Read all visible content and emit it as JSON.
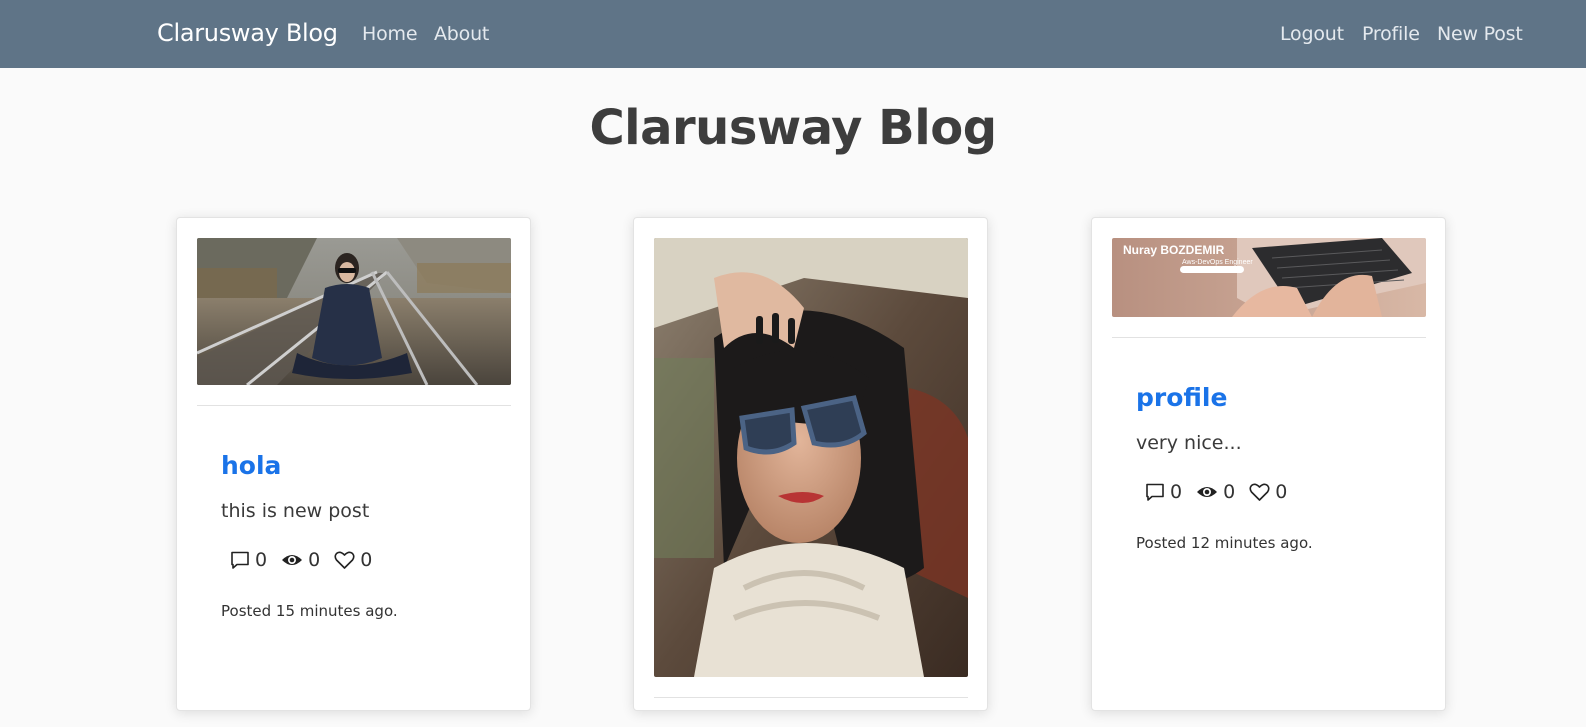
{
  "navbar": {
    "brand": "Clarusway Blog",
    "left_links": [
      "Home",
      "About"
    ],
    "right_links": [
      "Logout",
      "Profile",
      "New Post"
    ]
  },
  "page": {
    "title": "Clarusway Blog"
  },
  "posts": [
    {
      "title": "hola",
      "body": "this is new post",
      "comments": "0",
      "views": "0",
      "likes": "0",
      "posted": "Posted 15 minutes ago."
    },
    {
      "title": "",
      "body": "",
      "comments": "",
      "views": "",
      "likes": "",
      "posted": ""
    },
    {
      "title": "profile",
      "body": "very nice...",
      "comments": "0",
      "views": "0",
      "likes": "0",
      "posted": "Posted 12 minutes ago.",
      "image_text": {
        "name": "Nuray BOZDEMIR",
        "role": "Aws-DevOps Engineer"
      }
    }
  ],
  "icons": [
    "comment-icon",
    "eye-icon",
    "heart-icon"
  ],
  "colors": {
    "navbar": "#5f7487",
    "link": "#1a73e8"
  }
}
